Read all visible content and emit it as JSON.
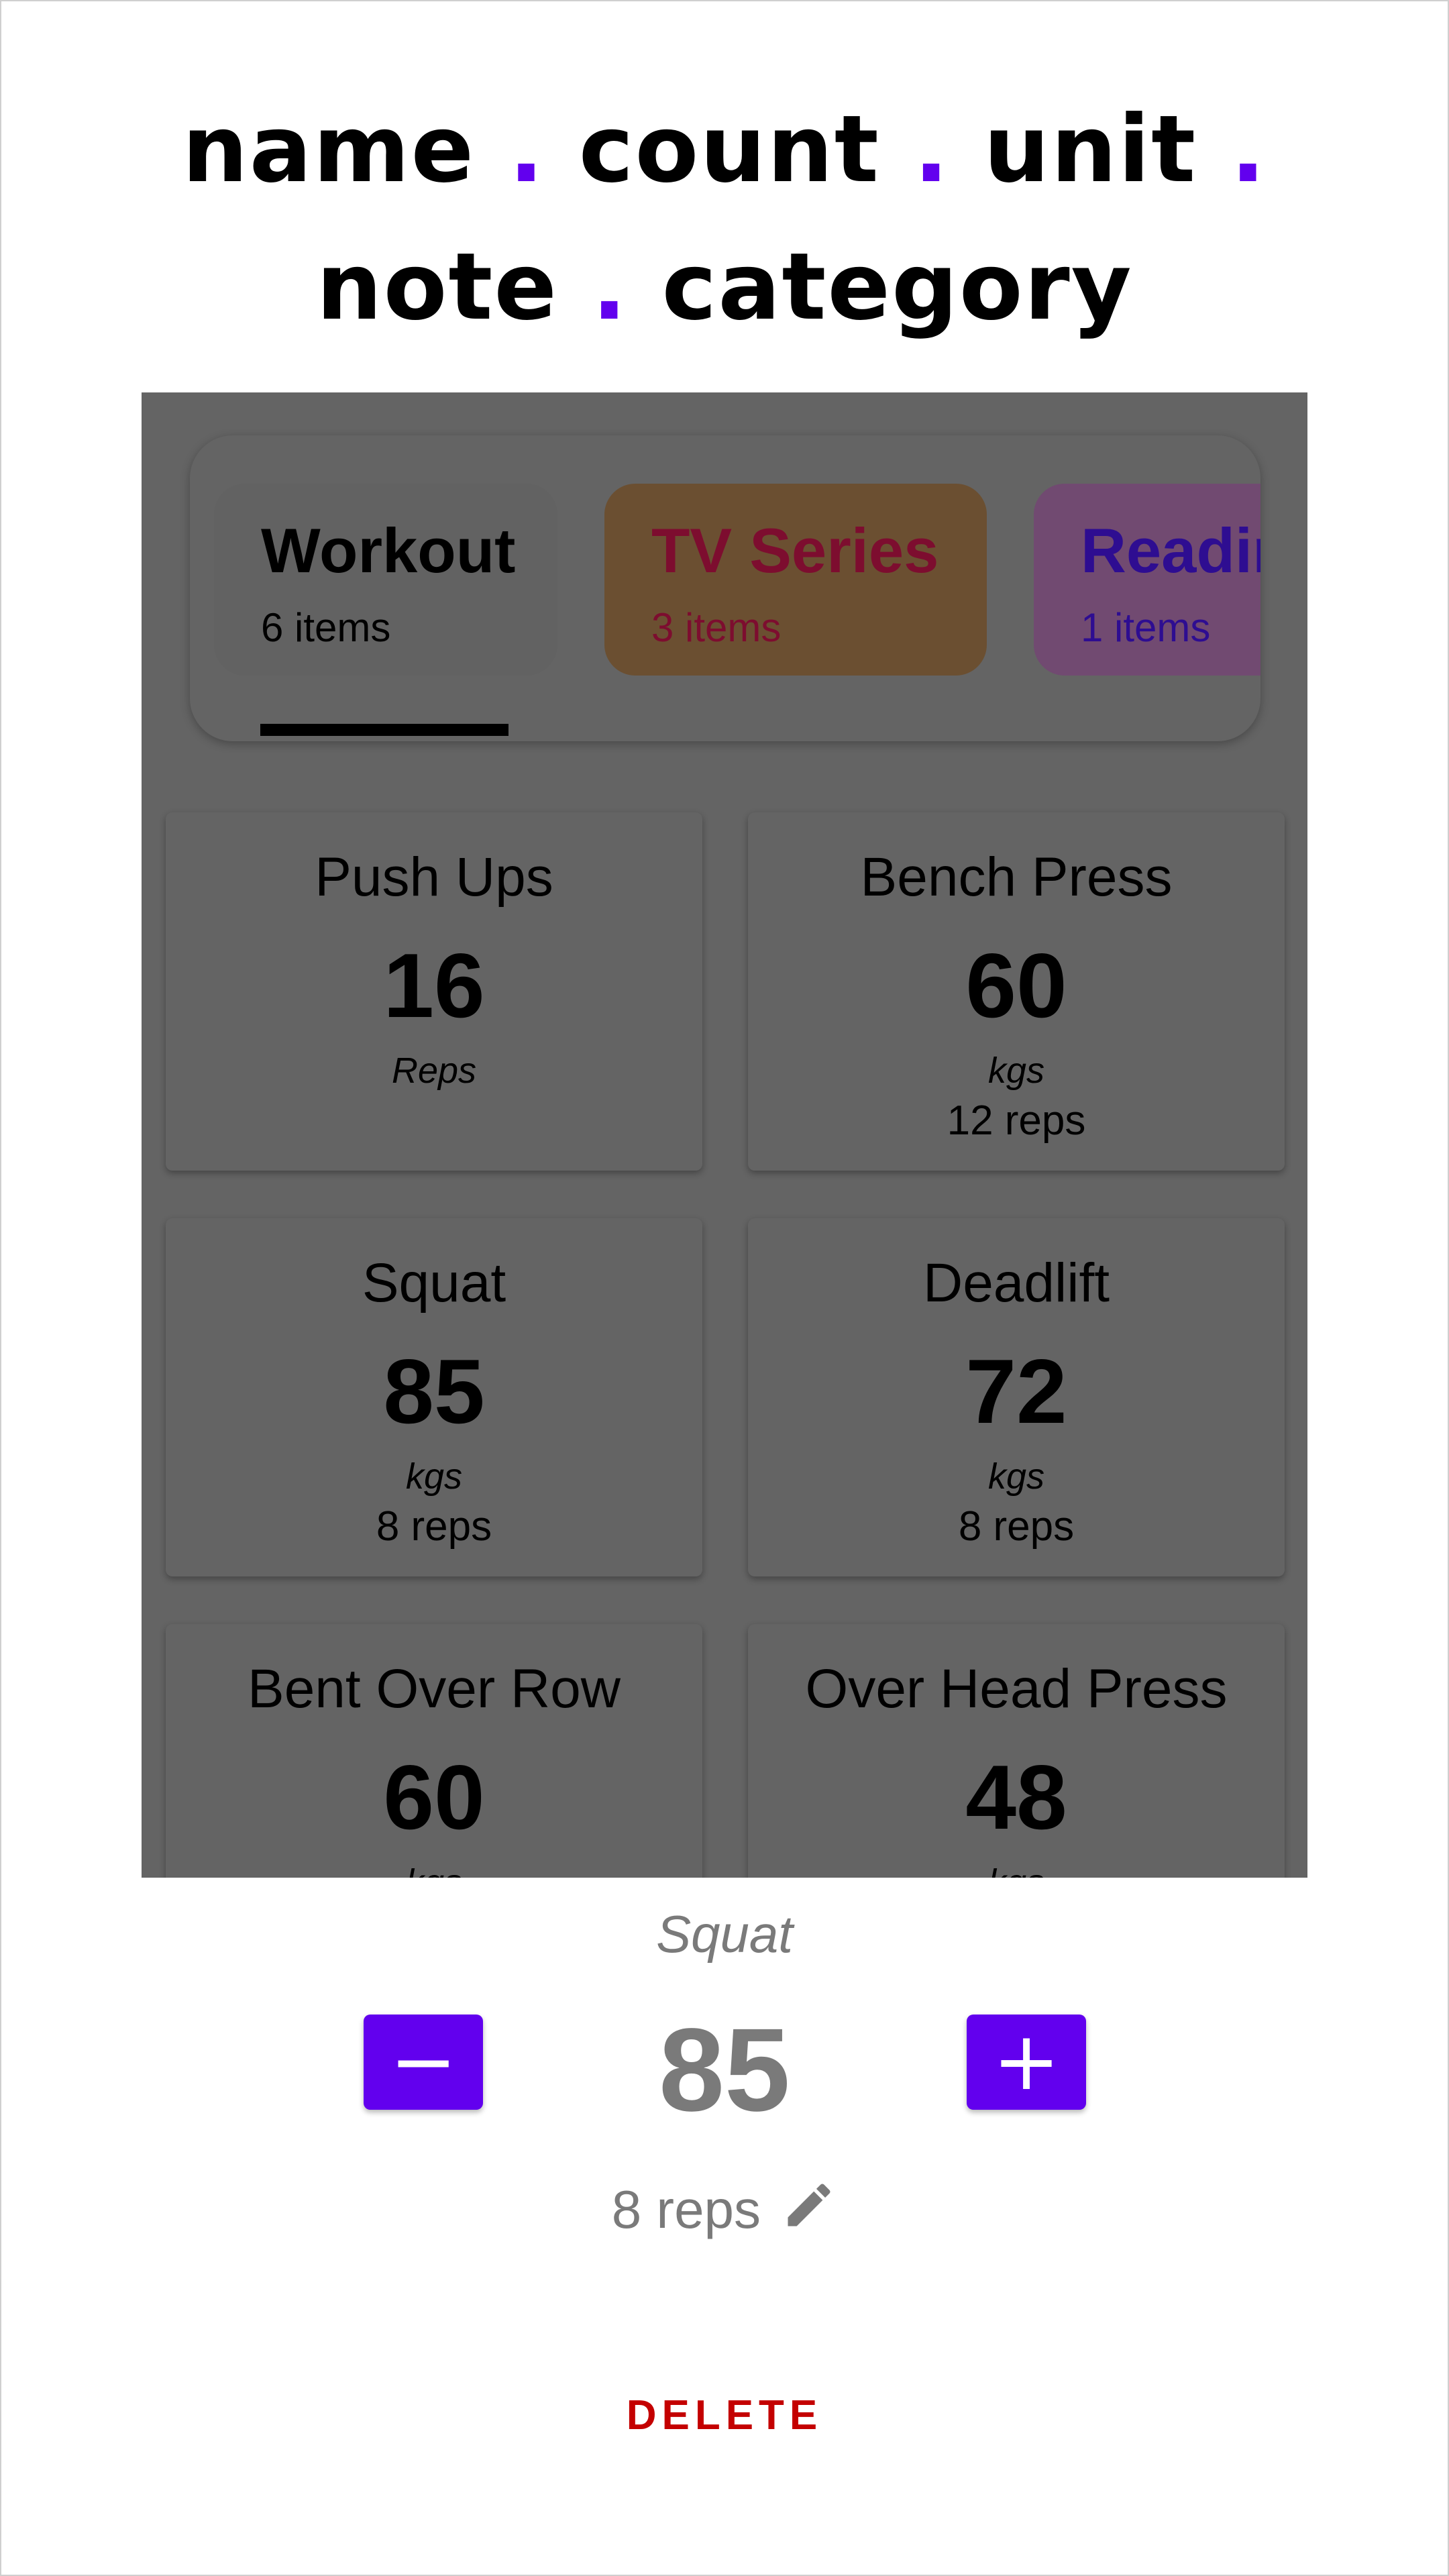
{
  "heading": {
    "line1": [
      {
        "word": "name",
        "dot": "."
      },
      {
        "word": "count",
        "dot": "."
      },
      {
        "word": "unit",
        "dot": "."
      }
    ],
    "line2": [
      {
        "word": "note",
        "dot": "."
      },
      {
        "word": "category",
        "dot": ""
      }
    ],
    "dot_color": "#6200ee"
  },
  "tabs": [
    {
      "title": "Workout",
      "count": "6 items",
      "selected": true
    },
    {
      "title": "TV Series",
      "count": "3 items",
      "selected": false
    },
    {
      "title": "Readin",
      "count": "1 items",
      "selected": false
    }
  ],
  "cards": [
    {
      "name": "Push Ups",
      "count": "16",
      "unit": "Reps",
      "note": ""
    },
    {
      "name": "Bench Press",
      "count": "60",
      "unit": "kgs",
      "note": "12 reps"
    },
    {
      "name": "Squat",
      "count": "85",
      "unit": "kgs",
      "note": "8 reps"
    },
    {
      "name": "Deadlift",
      "count": "72",
      "unit": "kgs",
      "note": "8 reps"
    },
    {
      "name": "Bent Over Row",
      "count": "60",
      "unit": "kgs",
      "note": ""
    },
    {
      "name": "Over Head Press",
      "count": "48",
      "unit": "kgs",
      "note": ""
    }
  ],
  "sheet": {
    "name": "Squat",
    "count": "85",
    "note": "8 reps",
    "minus_label": "−",
    "plus_label": "+",
    "delete_label": "DELETE",
    "edit_icon": "pencil-icon"
  },
  "colors": {
    "accent": "#6200ee",
    "delete": "#c40000",
    "scrim": "#646464"
  }
}
